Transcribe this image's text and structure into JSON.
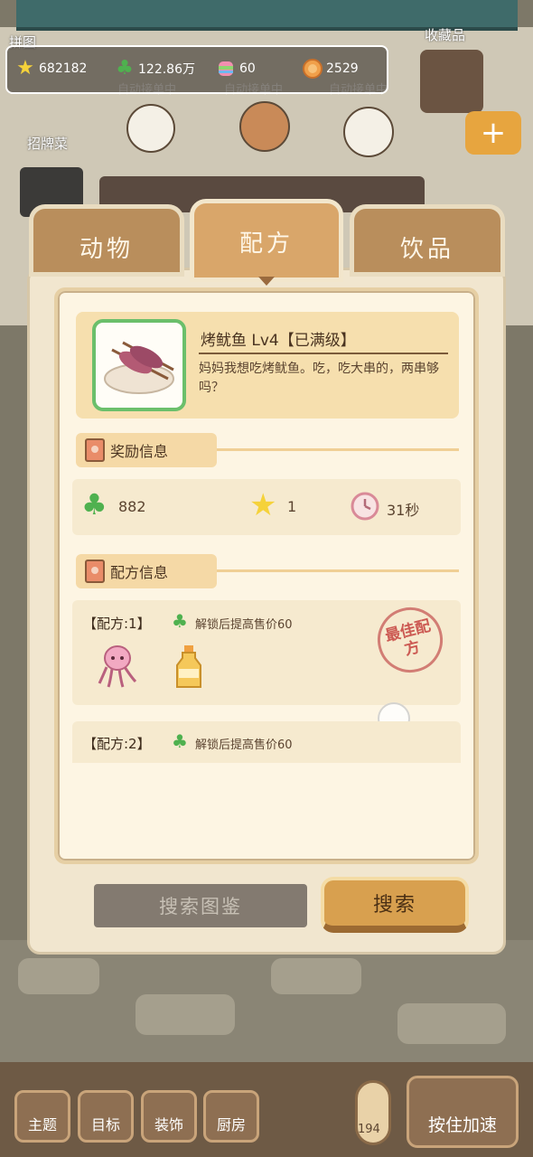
{
  "resources": {
    "stars": "682182",
    "clovers": "122.86万",
    "candy": "60",
    "coins": "2529"
  },
  "scene": {
    "puzzle_label": "拼图",
    "collection_label": "收藏品",
    "signature_label": "招牌菜",
    "auto_labels": [
      "自动接单中",
      "自动接单中",
      "自动接单中"
    ]
  },
  "tabs": [
    "动物",
    "配方",
    "饮品"
  ],
  "dish": {
    "title": "烤鱿鱼 Lv4【已满级】",
    "description": "妈妈我想吃烤鱿鱼。吃，吃大串的，两串够吗？"
  },
  "reward": {
    "section_title": "奖励信息",
    "clover_value": "882",
    "star_value": "1",
    "time_value": "31秒"
  },
  "recipe": {
    "section_title": "配方信息",
    "items": [
      {
        "title": "【配方:1】",
        "desc": "解锁后提高售价60",
        "stamp": "最佳配方"
      },
      {
        "title": "【配方:2】",
        "desc": "解锁后提高售价60"
      }
    ]
  },
  "buttons": {
    "search_book": "搜索图鉴",
    "search": "搜索"
  },
  "bottom_nav": {
    "items": [
      "主题",
      "目标",
      "装饰",
      "厨房"
    ],
    "temperature": "194",
    "speed": "按住加速"
  }
}
